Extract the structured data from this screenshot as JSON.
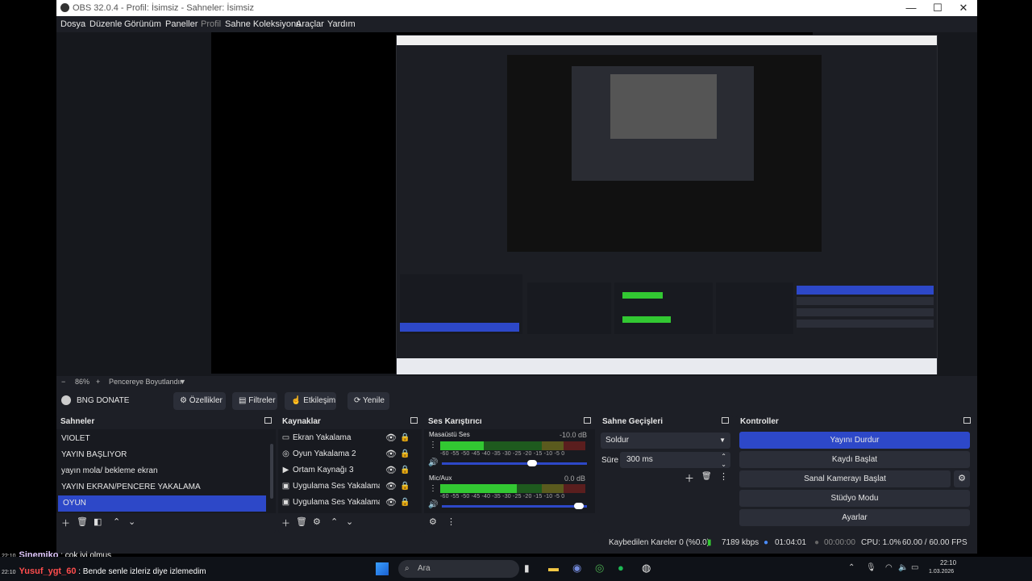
{
  "window": {
    "title": "OBS 32.0.4 - Profil: İsimsiz - Sahneler: İsimsiz",
    "controls": {
      "minimize": "—",
      "maximize": "☐",
      "close": "✕"
    }
  },
  "menu": [
    "Dosya",
    "Düzenle",
    "Görünüm",
    "Paneller",
    "Profil",
    "Sahne Koleksiyonu",
    "Araçlar",
    "Yardım"
  ],
  "zoom": {
    "minus": "−",
    "value": "86%",
    "plus": "+",
    "mode": "Pencereye Boyutlandır"
  },
  "source_bar": {
    "current": "BNG DONATE",
    "buttons": [
      "Özellikler",
      "Filtreler",
      "Etkileşim",
      "Yenile"
    ]
  },
  "scenes": {
    "title": "Sahneler",
    "items": [
      "VIOLET",
      "YAYIN BAŞLIYOR",
      "yayın mola/ bekleme ekran",
      "YAYIN EKRAN/PENCERE YAKALAMA",
      "OYUN"
    ],
    "selected": 4
  },
  "sources": {
    "title": "Kaynaklar",
    "items": [
      {
        "name": "Ekran Yakalama",
        "icon": "monitor-icon"
      },
      {
        "name": "Oyun Yakalama 2",
        "icon": "gamepad-icon"
      },
      {
        "name": "Ortam Kaynağı 3",
        "icon": "play-icon"
      },
      {
        "name": "Uygulama Ses Yakalama (B",
        "icon": "window-audio-icon"
      },
      {
        "name": "Uygulama Ses Yakalama (B",
        "icon": "window-audio-icon"
      }
    ]
  },
  "mixer": {
    "title": "Ses Karıştırıcı",
    "channels": [
      {
        "name": "Masaüstü Ses",
        "db": "-10.0 dB",
        "level": 0.3
      },
      {
        "name": "Mic/Aux",
        "db": "0.0 dB",
        "level": 0.53
      }
    ],
    "scale": [
      "-60",
      "-55",
      "-50",
      "-45",
      "-40",
      "-35",
      "-30",
      "-25",
      "-20",
      "-15",
      "-10",
      "-5",
      "0"
    ]
  },
  "transitions": {
    "title": "Sahne Geçişleri",
    "selected": "Soldur",
    "duration_label": "Süre",
    "duration": "300 ms"
  },
  "controls": {
    "title": "Kontroller",
    "buttons": [
      "Yayını Durdur",
      "Kaydı Başlat",
      "Sanal Kamerayı Başlat",
      "Stüdyo Modu",
      "Ayarlar"
    ]
  },
  "status": {
    "dropped": "Kaybedilen Kareler 0 (%0.0)",
    "bitrate": "7189 kbps",
    "live_time": "01:04:01",
    "rec_time": "00:00:00",
    "cpu": "CPU: 1.0%",
    "fps": "60.00 / 60.00 FPS"
  },
  "chat": [
    {
      "time": "22:10",
      "user": "Sinemiko",
      "text": ": çok iyi olmuş"
    },
    {
      "time": "22:10",
      "user": "Yusuf_ygt_60",
      "text": ": Bende senle izleriz diye izlemedim"
    }
  ],
  "taskbar": {
    "search_placeholder": "Ara",
    "time": "22:10",
    "date": "1.03.2026"
  },
  "colors": {
    "accent": "#2d48c8",
    "panel": "#1d1f26",
    "meter_green": "#32c832",
    "meter_yellow": "#c8c832",
    "meter_red": "#c83232"
  }
}
